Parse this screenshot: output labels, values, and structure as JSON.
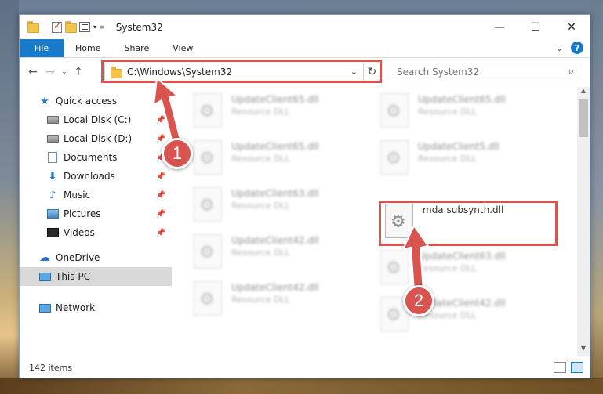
{
  "window": {
    "title": "System32"
  },
  "window_controls": {
    "minimize": "—",
    "maximize": "☐",
    "close": "✕"
  },
  "ribbon": {
    "file_tab": "File",
    "tabs": [
      "Home",
      "Share",
      "View"
    ],
    "collapse_glyph": "⌄",
    "help_glyph": "?"
  },
  "nav": {
    "back": "←",
    "forward": "→",
    "recent": "⌄",
    "up": "↑",
    "address": "C:\\Windows\\System32",
    "address_dropdown": "⌄",
    "refresh": "↻",
    "search_placeholder": "Search System32",
    "search_glyph": "⌕"
  },
  "sidebar": {
    "items": [
      {
        "label": "Quick access",
        "icon": "star-icon",
        "pinned": false
      },
      {
        "label": "Local Disk (C:)",
        "icon": "drive-icon",
        "pinned": true
      },
      {
        "label": "Local Disk (D:)",
        "icon": "drive-icon",
        "pinned": true
      },
      {
        "label": "Documents",
        "icon": "documents-icon",
        "pinned": true
      },
      {
        "label": "Downloads",
        "icon": "downloads-icon",
        "pinned": true
      },
      {
        "label": "Music",
        "icon": "music-icon",
        "pinned": true
      },
      {
        "label": "Pictures",
        "icon": "pictures-icon",
        "pinned": true
      },
      {
        "label": "Videos",
        "icon": "videos-icon",
        "pinned": true
      },
      {
        "label": "OneDrive",
        "icon": "onedrive-icon",
        "pinned": false
      },
      {
        "label": "This PC",
        "icon": "this-pc-icon",
        "pinned": false,
        "selected": true
      },
      {
        "label": "Network",
        "icon": "network-icon",
        "pinned": false
      }
    ]
  },
  "files": [
    {
      "name": "UpdateClient65.dll",
      "type": "Resource DLL"
    },
    {
      "name": "UpdateClient65.dll",
      "type": "Resource DLL"
    },
    {
      "name": "UpdateClient65.dll",
      "type": "Resource DLL"
    },
    {
      "name": "UpdateClient5.dll",
      "type": "Resource DLL"
    },
    {
      "name": "UpdateClient63.dll",
      "type": "Resource DLL"
    },
    {
      "name": "mda subsynth.dll",
      "type": ""
    },
    {
      "name": "UpdateClient42.dll",
      "type": "Resource DLL"
    },
    {
      "name": "UpdateClient63.dll",
      "type": "Resource DLL"
    },
    {
      "name": "UpdateClient42.dll",
      "type": "Resource DLL"
    },
    {
      "name": "UpdateClient42.dll",
      "type": "Resource DLL"
    }
  ],
  "status": {
    "items": "142 items"
  },
  "callouts": {
    "step1": "1",
    "step2": "2"
  },
  "colors": {
    "accent": "#1979ca",
    "highlight": "#d9534f"
  }
}
